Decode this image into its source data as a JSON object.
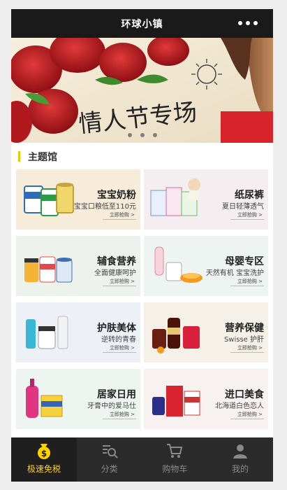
{
  "header": {
    "title": "环球小镇"
  },
  "banner": {
    "headline": "情人节专场",
    "dots": 3
  },
  "section": {
    "title": "主题馆"
  },
  "tiles": [
    {
      "name": "宝宝奶粉",
      "sub": "宝宝口粮低至110元",
      "more": "立即抢购 >",
      "bg": "#f6ecd9"
    },
    {
      "name": "纸尿裤",
      "sub": "夏日轻薄透气",
      "more": "立即抢购 >",
      "bg": "#f4eef0"
    },
    {
      "name": "辅食营养",
      "sub": "全面健康呵护",
      "more": "立即抢购 >",
      "bg": "#eef2ec"
    },
    {
      "name": "母婴专区",
      "sub": "天然有机 宝宝洗护",
      "more": "立即抢购 >",
      "bg": "#eef4f2"
    },
    {
      "name": "护肤美体",
      "sub": "逆转的青春",
      "more": "立即抢购 >",
      "bg": "#edf1f7"
    },
    {
      "name": "营养保健",
      "sub": "Swisse 护肝",
      "more": "立即抢购 >",
      "bg": "#f5f1e8"
    },
    {
      "name": "居家日用",
      "sub": "牙膏中的爱马仕",
      "more": "立即抢购 >",
      "bg": "#eef5f0"
    },
    {
      "name": "进口美食",
      "sub": "北海道白色恋人",
      "more": "立即抢购 >",
      "bg": "#f7f2f0"
    }
  ],
  "tabbar": [
    {
      "label": "极速免税",
      "icon": "money-bag-icon",
      "active": true
    },
    {
      "label": "分类",
      "icon": "category-search-icon",
      "active": false
    },
    {
      "label": "购物车",
      "icon": "cart-icon",
      "active": false
    },
    {
      "label": "我的",
      "icon": "profile-icon",
      "active": false
    }
  ],
  "colors": {
    "accent": "#ffd200",
    "topbar": "#1a1a1a",
    "tabbar": "#2b2b2b"
  }
}
